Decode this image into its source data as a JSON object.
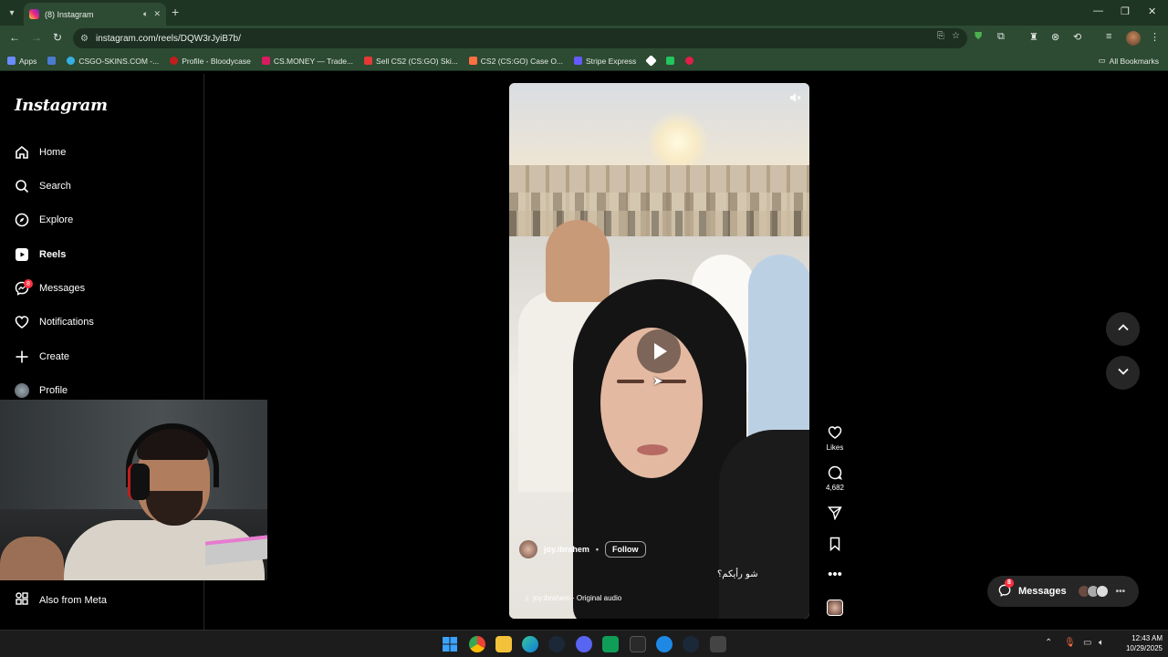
{
  "browser": {
    "tab": {
      "title": "(8) Instagram"
    },
    "url": "instagram.com/reels/DQW3rJyiB7b/",
    "bookmarks": [
      {
        "label": "Apps",
        "color": "#6b8cff"
      },
      {
        "label": "",
        "color": "#4a7bd1"
      },
      {
        "label": "CSGO-SKINS.COM -...",
        "color": "#35b0e6"
      },
      {
        "label": "Profile - Bloodycase",
        "color": "#c21d1d"
      },
      {
        "label": "CS.MONEY — Trade...",
        "color": "#d81b60"
      },
      {
        "label": "Sell CS2 (CS:GO) Ski...",
        "color": "#e53935"
      },
      {
        "label": "CS2 (CS:GO) Case O...",
        "color": "#ff7043"
      },
      {
        "label": "Stripe Express",
        "color": "#635bff"
      }
    ],
    "all_bookmarks": "All Bookmarks"
  },
  "sidebar": {
    "logo": "Instagram",
    "items": [
      {
        "label": "Home",
        "icon": "home-icon"
      },
      {
        "label": "Search",
        "icon": "search-icon"
      },
      {
        "label": "Explore",
        "icon": "compass-icon"
      },
      {
        "label": "Reels",
        "icon": "reels-icon",
        "active": true
      },
      {
        "label": "Messages",
        "icon": "messenger-icon",
        "badge": "8"
      },
      {
        "label": "Notifications",
        "icon": "heart-icon"
      },
      {
        "label": "Create",
        "icon": "plus-icon"
      },
      {
        "label": "Profile",
        "icon": "avatar"
      }
    ],
    "also_from_meta": "Also from Meta"
  },
  "reel": {
    "author": "joy.ibrahem",
    "follow": "Follow",
    "caption": "شو رأيكم؟",
    "audio": "joy.ibrahem · Original audio",
    "actions": {
      "likes_label": "Likes",
      "comments_count": "4,682"
    }
  },
  "messages_pill": {
    "label": "Messages",
    "badge": "8"
  },
  "taskbar": {
    "time": "12:43 AM",
    "date": "10/29/2025"
  },
  "colors": {
    "chrome_green": "#2d4a32",
    "badge_red": "#ff3040",
    "ig_bg": "#000000"
  }
}
